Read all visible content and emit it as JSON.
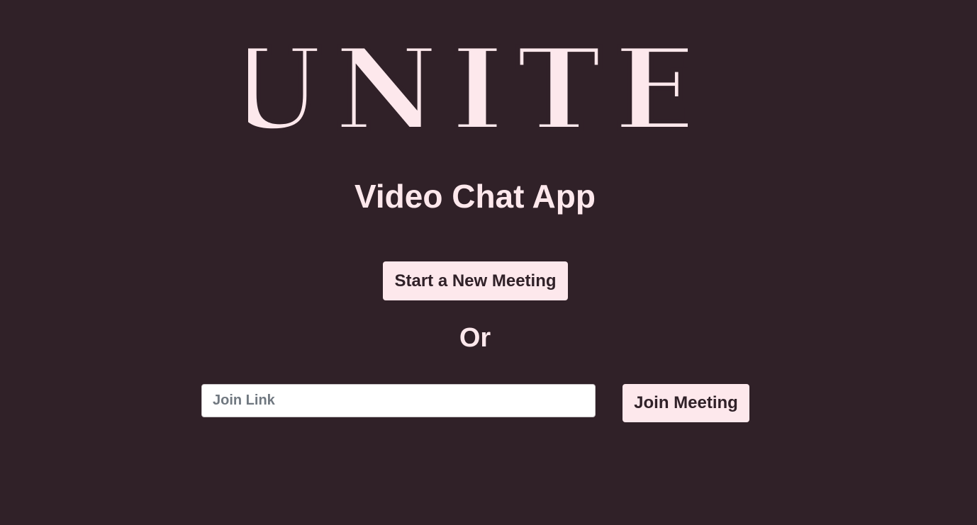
{
  "app": {
    "logo_text": "UNITE",
    "subtitle": "Video Chat App"
  },
  "actions": {
    "new_meeting_label": "Start a New Meeting",
    "or_label": "Or",
    "join_link_placeholder": "Join Link",
    "join_link_value": "",
    "join_meeting_label": "Join Meeting"
  },
  "colors": {
    "background": "#302128",
    "accent": "#fde8ec",
    "button_text": "#302128"
  }
}
